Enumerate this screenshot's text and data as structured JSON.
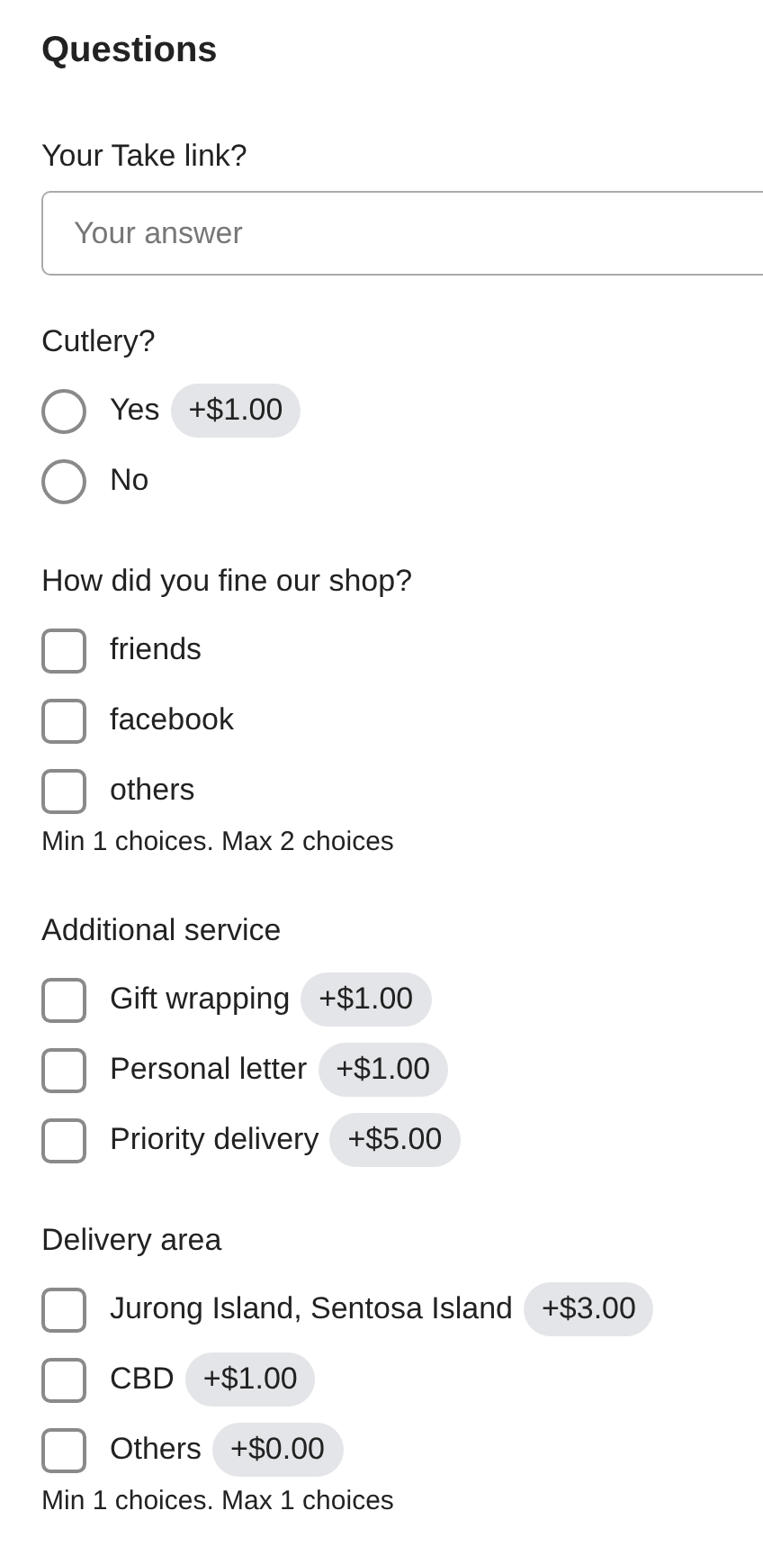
{
  "title": "Questions",
  "questions": [
    {
      "kind": "text",
      "label": "Your Take link?",
      "placeholder": "Your answer"
    },
    {
      "kind": "radio",
      "label": "Cutlery?",
      "options": [
        {
          "label": "Yes",
          "price": "+$1.00",
          "selected": false
        },
        {
          "label": "No",
          "selected": false
        }
      ]
    },
    {
      "kind": "checkbox",
      "label": "How did you fine our shop?",
      "options": [
        {
          "label": "friends",
          "checked": false
        },
        {
          "label": "facebook",
          "checked": false
        },
        {
          "label": "others",
          "checked": false
        }
      ],
      "note": "Min 1 choices. Max 2 choices"
    },
    {
      "kind": "checkbox",
      "label": "Additional service",
      "options": [
        {
          "label": "Gift wrapping",
          "price": "+$1.00",
          "checked": false
        },
        {
          "label": "Personal letter",
          "price": "+$1.00",
          "checked": false
        },
        {
          "label": "Priority delivery",
          "price": "+$5.00",
          "checked": false
        }
      ]
    },
    {
      "kind": "checkbox",
      "label": "Delivery area",
      "options": [
        {
          "label": "Jurong Island, Sentosa Island",
          "price": "+$3.00",
          "checked": false
        },
        {
          "label": "CBD",
          "price": "+$1.00",
          "checked": false
        },
        {
          "label": "Others",
          "price": "+$0.00",
          "checked": false
        }
      ],
      "note": "Min 1 choices. Max 1 choices"
    }
  ]
}
